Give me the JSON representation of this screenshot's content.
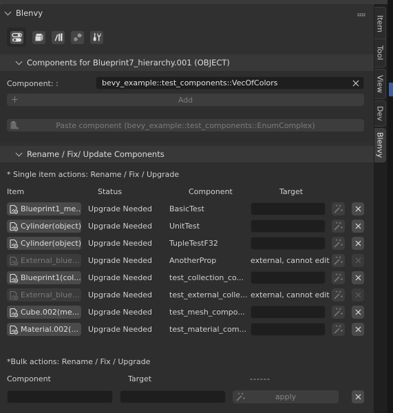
{
  "panel": {
    "title": "Blenvy"
  },
  "sidebar_tabs": [
    {
      "label": "Item",
      "active": false
    },
    {
      "label": "Tool",
      "active": false
    },
    {
      "label": "View",
      "active": false
    },
    {
      "label": "Dev",
      "active": false
    },
    {
      "label": "Blenvy",
      "active": true
    }
  ],
  "toolbar": {
    "buttons": [
      {
        "icon": "toggle-components-icon",
        "active": true
      },
      {
        "icon": "blueprints-icon",
        "active": false
      },
      {
        "icon": "assets-library-icon",
        "active": false
      },
      {
        "icon": "settings-gears-icon",
        "active": false
      },
      {
        "icon": "tools-icon",
        "active": false
      }
    ]
  },
  "components_section": {
    "title": "Components for Blueprint7_hierarchy.001 (OBJECT)",
    "component_label": "Component: :",
    "component_value": "bevy_example::test_components::VecOfColors",
    "add_label": "Add",
    "paste_label": "Paste component (bevy_example::test_components::EnumComplex)"
  },
  "rename_section": {
    "title": "Rename / Fix/ Update Components",
    "single_label": "* Single item actions: Rename / Fix / Upgrade",
    "columns": {
      "item": "Item",
      "status": "Status",
      "component": "Component",
      "target": "Target"
    },
    "rows": [
      {
        "item": "Blueprint1_me...",
        "status": "Upgrade Needed",
        "component": "BasicTest",
        "target": "",
        "external": false
      },
      {
        "item": "Cylinder(object)",
        "status": "Upgrade Needed",
        "component": "UnitTest",
        "target": "",
        "external": false
      },
      {
        "item": "Cylinder(object)",
        "status": "Upgrade Needed",
        "component": "TupleTestF32",
        "target": "",
        "external": false
      },
      {
        "item": "External_blue...",
        "status": "Upgrade Needed",
        "component": "AnotherProp",
        "target": "external, cannot edit",
        "external": true
      },
      {
        "item": "Blueprint1(col...",
        "status": "Upgrade Needed",
        "component": "test_collection_co...",
        "target": "",
        "external": false
      },
      {
        "item": "External_blue...",
        "status": "Upgrade Needed",
        "component": "test_external_colle...",
        "target": "external, cannot edit",
        "external": true
      },
      {
        "item": "Cube.002(me...",
        "status": "Upgrade Needed",
        "component": "test_mesh_compo...",
        "target": "",
        "external": false
      },
      {
        "item": "Material.002(...",
        "status": "Upgrade Needed",
        "component": "test_material_com...",
        "target": "",
        "external": false
      }
    ],
    "bulk_label": "*Bulk actions: Rename / Fix / Upgrade",
    "bulk_columns": {
      "component": "Component",
      "target": "Target",
      "placeholder": "------"
    },
    "bulk_component_value": "",
    "bulk_target_value": "",
    "apply_label": "apply"
  }
}
